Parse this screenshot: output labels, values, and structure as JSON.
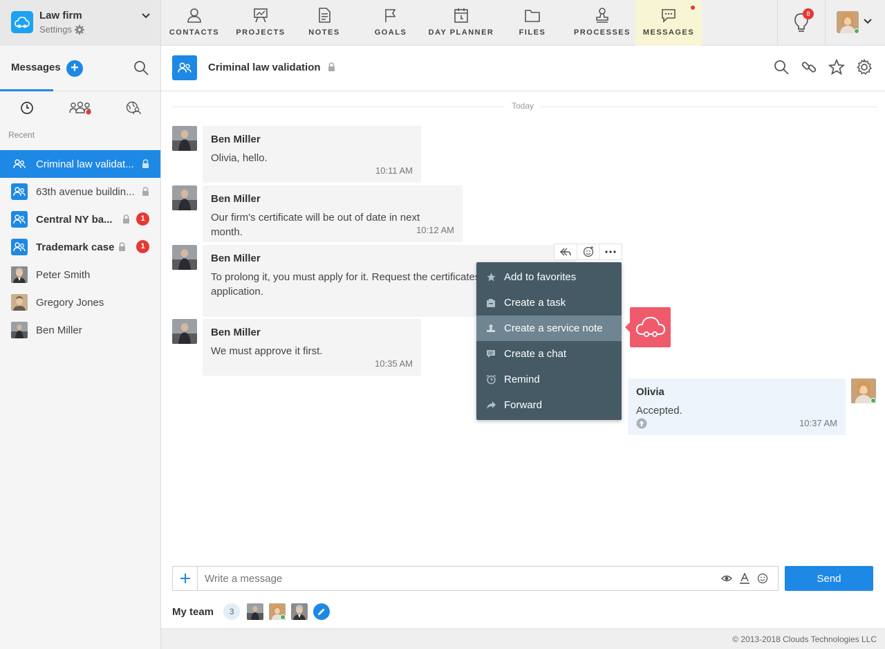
{
  "org": {
    "name": "Law firm",
    "settings_label": "Settings"
  },
  "nav": [
    {
      "label": "CONTACTS",
      "icon": "person-icon"
    },
    {
      "label": "PROJECTS",
      "icon": "easel-icon"
    },
    {
      "label": "NOTES",
      "icon": "note-icon"
    },
    {
      "label": "GOALS",
      "icon": "flag-icon"
    },
    {
      "label": "DAY PLANNER",
      "icon": "calendar-icon"
    },
    {
      "label": "FILES",
      "icon": "folder-icon"
    },
    {
      "label": "PROCESSES",
      "icon": "stamp-icon"
    },
    {
      "label": "MESSAGES",
      "icon": "chat-bubble-icon",
      "active": true
    }
  ],
  "notifications": {
    "count": "8"
  },
  "sidebar": {
    "title": "Messages",
    "add_label": "+",
    "recent_label": "Recent",
    "chats": [
      {
        "name": "Criminal law validat...",
        "locked": true,
        "active": true
      },
      {
        "name": "63th avenue buildin...",
        "locked": true
      },
      {
        "name": "Central NY ba...",
        "locked": true,
        "unread": "1"
      },
      {
        "name": "Trademark case",
        "locked": true,
        "unread": "1"
      },
      {
        "name": "Peter Smith"
      },
      {
        "name": "Gregory Jones"
      },
      {
        "name": "Ben Miller"
      }
    ]
  },
  "channel": {
    "title": "Criminal law validation"
  },
  "day_label": "Today",
  "messages": [
    {
      "author": "Ben Miller",
      "text": "Olivia, hello.",
      "time": "10:11 AM"
    },
    {
      "author": "Ben Miller",
      "text": "Our firm's certificate will be out of date in next month.",
      "time": "10:12 AM"
    },
    {
      "author": "Ben Miller",
      "text": "To prolong it, you must apply for it. Request the certificates and compose an application.",
      "time": ""
    },
    {
      "author": "Ben Miller",
      "text": "We must approve it first.",
      "time": "10:35 AM"
    },
    {
      "author": "Olivia",
      "text": "Accepted.",
      "time": "10:37 AM"
    }
  ],
  "context_menu": [
    {
      "label": "Add to favorites",
      "icon": "star-icon"
    },
    {
      "label": "Create a task",
      "icon": "task-icon"
    },
    {
      "label": "Create a service note",
      "icon": "stamp-icon",
      "hover": true
    },
    {
      "label": "Create a chat",
      "icon": "chat-icon"
    },
    {
      "label": "Remind",
      "icon": "alarm-icon"
    },
    {
      "label": "Forward",
      "icon": "forward-icon"
    }
  ],
  "composer": {
    "placeholder": "Write a message",
    "send_label": "Send"
  },
  "team": {
    "label": "My team",
    "count": "3"
  },
  "footer": {
    "copyright": "© 2013-2018 Clouds Technologies LLC"
  },
  "colors": {
    "accent": "#1e88e5",
    "menu_bg": "#455a64",
    "badge": "#e53935",
    "service_note": "#ef5b6b",
    "active_tab": "#f7f5d3"
  }
}
